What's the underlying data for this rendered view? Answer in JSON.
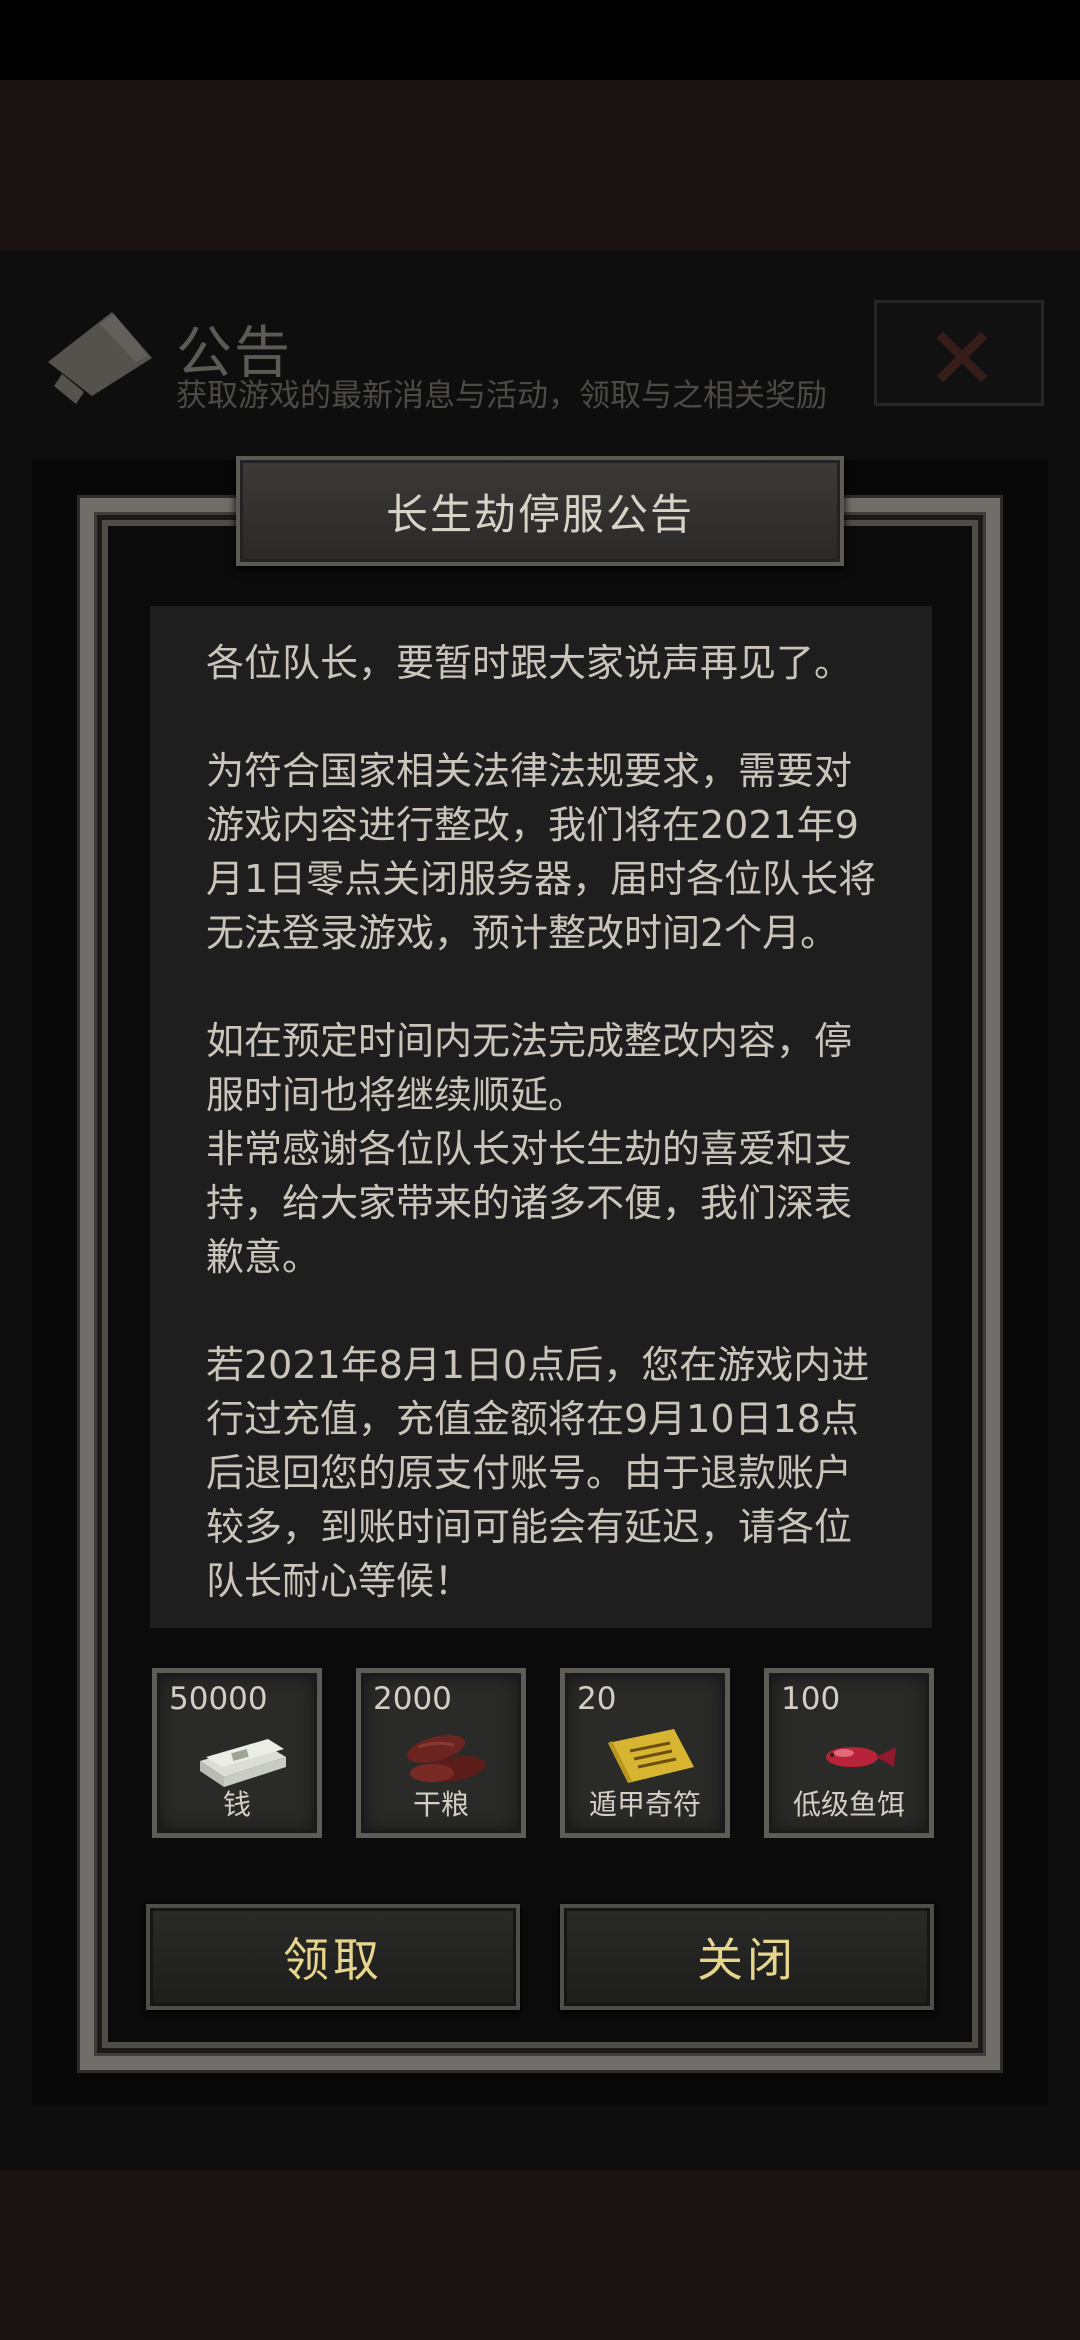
{
  "header": {
    "title": "公告",
    "subtitle": "获取游戏的最新消息与活动，领取与之相关奖励",
    "icon": "megaphone-icon"
  },
  "modal": {
    "title": "长生劫停服公告",
    "paragraphs": [
      "各位队长，要暂时跟大家说声再见了。",
      "为符合国家相关法律法规要求，需要对游戏内容进行整改，我们将在2021年9月1日零点关闭服务器，届时各位队长将无法登录游戏，预计整改时间2个月。",
      "如在预定时间内无法完成整改内容，停服时间也将继续顺延。",
      "非常感谢各位队长对长生劫的喜爱和支持，给大家带来的诸多不便，我们深表歉意。",
      "若2021年8月1日0点后，您在游戏内进行过充值，充值金额将在9月10日18点后退回您的原支付账号。由于退款账户较多，到账时间可能会有延迟，请各位队长耐心等候！"
    ],
    "rewards": [
      {
        "count": "50000",
        "name": "钱",
        "icon": "money-stack-icon"
      },
      {
        "count": "2000",
        "name": "干粮",
        "icon": "dried-meat-icon"
      },
      {
        "count": "20",
        "name": "遁甲奇符",
        "icon": "talisman-icon"
      },
      {
        "count": "100",
        "name": "低级鱼饵",
        "icon": "fish-bait-icon"
      }
    ],
    "claim_label": "领取",
    "close_label": "关闭"
  }
}
